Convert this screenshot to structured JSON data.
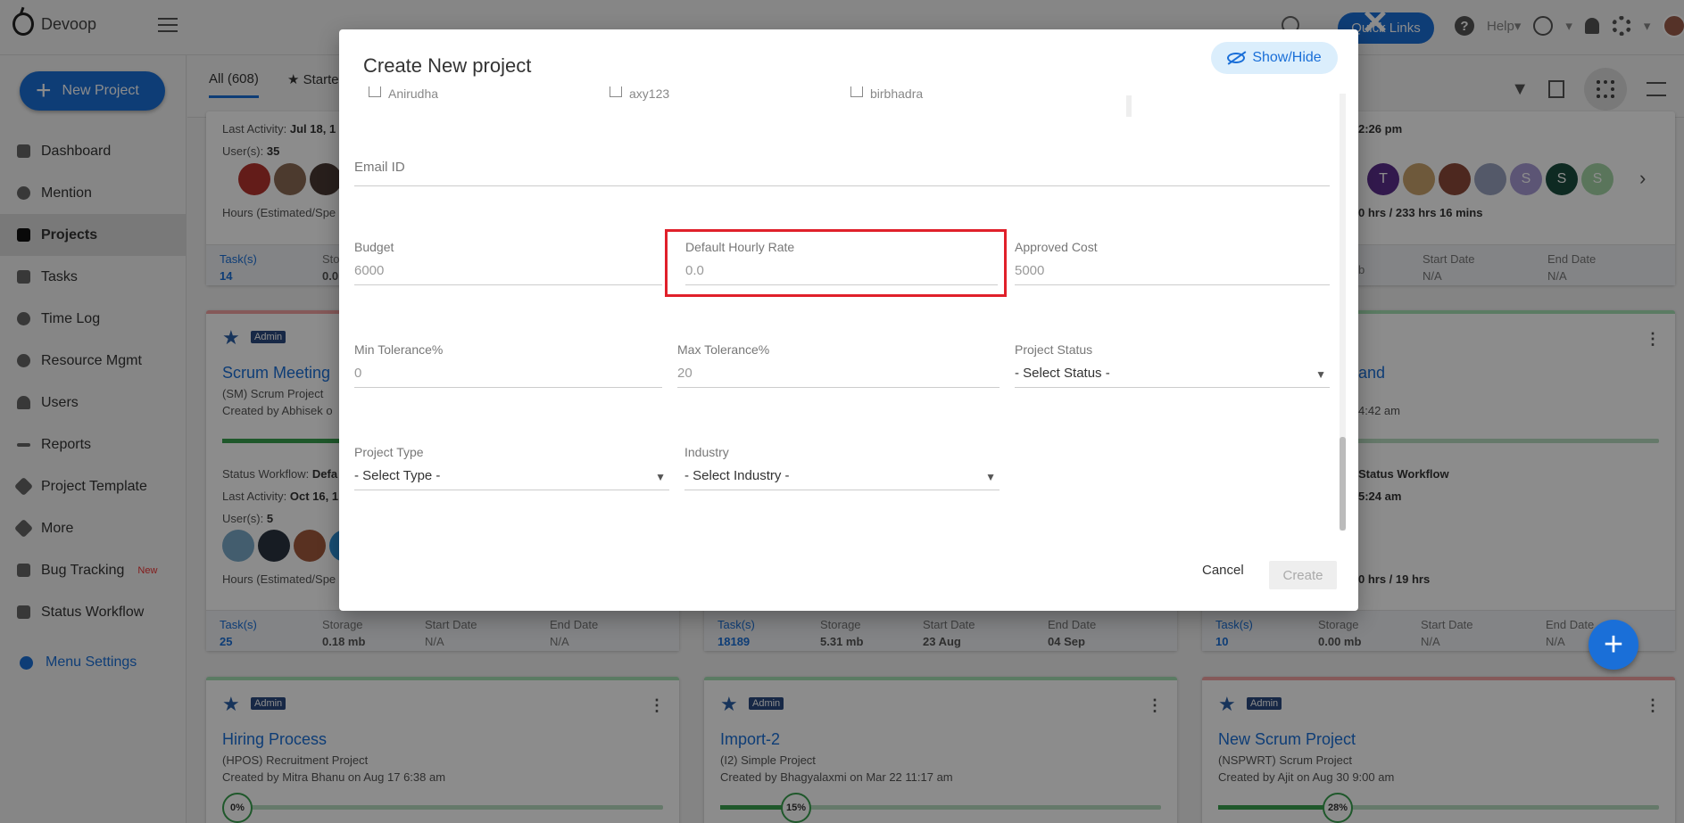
{
  "app": {
    "name": "Devoop"
  },
  "topbar": {
    "quick_links": "Quick Links",
    "help": "Help"
  },
  "sidebar": {
    "new_project": "New Project",
    "items": [
      {
        "label": "Dashboard",
        "icon": "dashboard-icon"
      },
      {
        "label": "Mention",
        "icon": "at-icon"
      },
      {
        "label": "Projects",
        "icon": "briefcase-icon",
        "active": true
      },
      {
        "label": "Tasks",
        "icon": "clipboard-icon"
      },
      {
        "label": "Time Log",
        "icon": "clock-icon"
      },
      {
        "label": "Resource Mgmt",
        "icon": "resource-icon"
      },
      {
        "label": "Users",
        "icon": "user-icon"
      },
      {
        "label": "Reports",
        "icon": "chart-line-icon"
      },
      {
        "label": "Project Template",
        "icon": "layers-icon"
      },
      {
        "label": "More",
        "icon": "layers-icon"
      },
      {
        "label": "Bug Tracking",
        "icon": "bug-icon",
        "badge": "New"
      },
      {
        "label": "Status Workflow",
        "icon": "workflow-icon"
      }
    ],
    "menu_settings": "Menu Settings"
  },
  "subbar": {
    "tab_all": "All (608)",
    "tab_starred": "Starte"
  },
  "cards": {
    "c1": {
      "last_activity_label": "Last Activity:",
      "last_activity": "Jul 18, 1",
      "users_label": "User(s):",
      "users": "35",
      "hours": "Hours (Estimated/Spe",
      "tasks_label": "Task(s)",
      "tasks": "14",
      "storage_label": "Stor",
      "storage": "0.0"
    },
    "c3": {
      "time": "2:26 pm",
      "hours": "0 hrs / 233 hrs 16 mins",
      "start_label": "Start Date",
      "start": "N/A",
      "end_label": "End Date",
      "end": "N/A",
      "storage": "b",
      "avatars": [
        "T",
        "S",
        "S",
        "S"
      ]
    },
    "c4": {
      "badge": "Admin",
      "title": "Scrum Meeting",
      "sub": "(SM) Scrum Project",
      "by": "Created by Abhisek o",
      "wf_label": "Status Workflow:",
      "wf": "Defa",
      "last_activity_label": "Last Activity:",
      "last_activity": "Oct 16, 1",
      "users_label": "User(s):",
      "users": "5",
      "hours": "Hours (Estimated/Spe",
      "tasks_label": "Task(s)",
      "tasks": "25",
      "storage_label": "Storage",
      "storage": "0.18 mb",
      "start_label": "Start Date",
      "start": "N/A",
      "end_label": "End Date",
      "end": "N/A"
    },
    "c5": {
      "tasks_label": "Task(s)",
      "tasks": "18189",
      "storage_label": "Storage",
      "storage": "5.31 mb",
      "start_label": "Start Date",
      "start": "23 Aug",
      "end_label": "End Date",
      "end": "04 Sep"
    },
    "c6": {
      "title": "and",
      "time": "4:42 am",
      "wf": "Status Workflow",
      "time2": "5:24 am",
      "hours": "0 hrs / 19 hrs",
      "tasks_label": "Task(s)",
      "tasks": "10",
      "storage_label": "Storage",
      "storage": "0.00 mb",
      "start_label": "Start Date",
      "start": "N/A",
      "end_label": "End Date",
      "end": "N/A"
    },
    "c7": {
      "badge": "Admin",
      "title": "Hiring Process",
      "sub": "(HPOS) Recruitment Project",
      "by": "Created by Mitra Bhanu on Aug 17 6:38 am",
      "progress": "0%",
      "progress_value": 0
    },
    "c8": {
      "badge": "Admin",
      "title": "Import-2",
      "sub": "(I2) Simple Project",
      "by": "Created by Bhagyalaxmi on Mar 22 11:17 am",
      "progress": "15%",
      "progress_value": 15
    },
    "c9": {
      "badge": "Admin",
      "title": "New Scrum Project",
      "sub": "(NSPWRT) Scrum Project",
      "by": "Created by Ajit on Aug 30 9:00 am",
      "progress": "28%",
      "progress_value": 28
    }
  },
  "modal": {
    "title": "Create New project",
    "show_hide": "Show/Hide",
    "checkboxes": [
      "Anirudha",
      "axy123",
      "birbhadra"
    ],
    "email": {
      "label": "Email ID",
      "value": ""
    },
    "budget": {
      "label": "Budget",
      "value": "6000"
    },
    "hourly_rate": {
      "label": "Default Hourly Rate",
      "value": "0.0"
    },
    "approved_cost": {
      "label": "Approved Cost",
      "value": "5000"
    },
    "min_tol": {
      "label": "Min Tolerance%",
      "value": "0"
    },
    "max_tol": {
      "label": "Max Tolerance%",
      "value": "20"
    },
    "status": {
      "label": "Project Status",
      "value": "- Select Status -"
    },
    "type": {
      "label": "Project Type",
      "value": "- Select Type -"
    },
    "industry": {
      "label": "Industry",
      "value": "- Select Industry -"
    },
    "cancel": "Cancel",
    "create": "Create"
  },
  "colors": {
    "accent": "#1a6fd8",
    "highlight": "#e0202a"
  }
}
